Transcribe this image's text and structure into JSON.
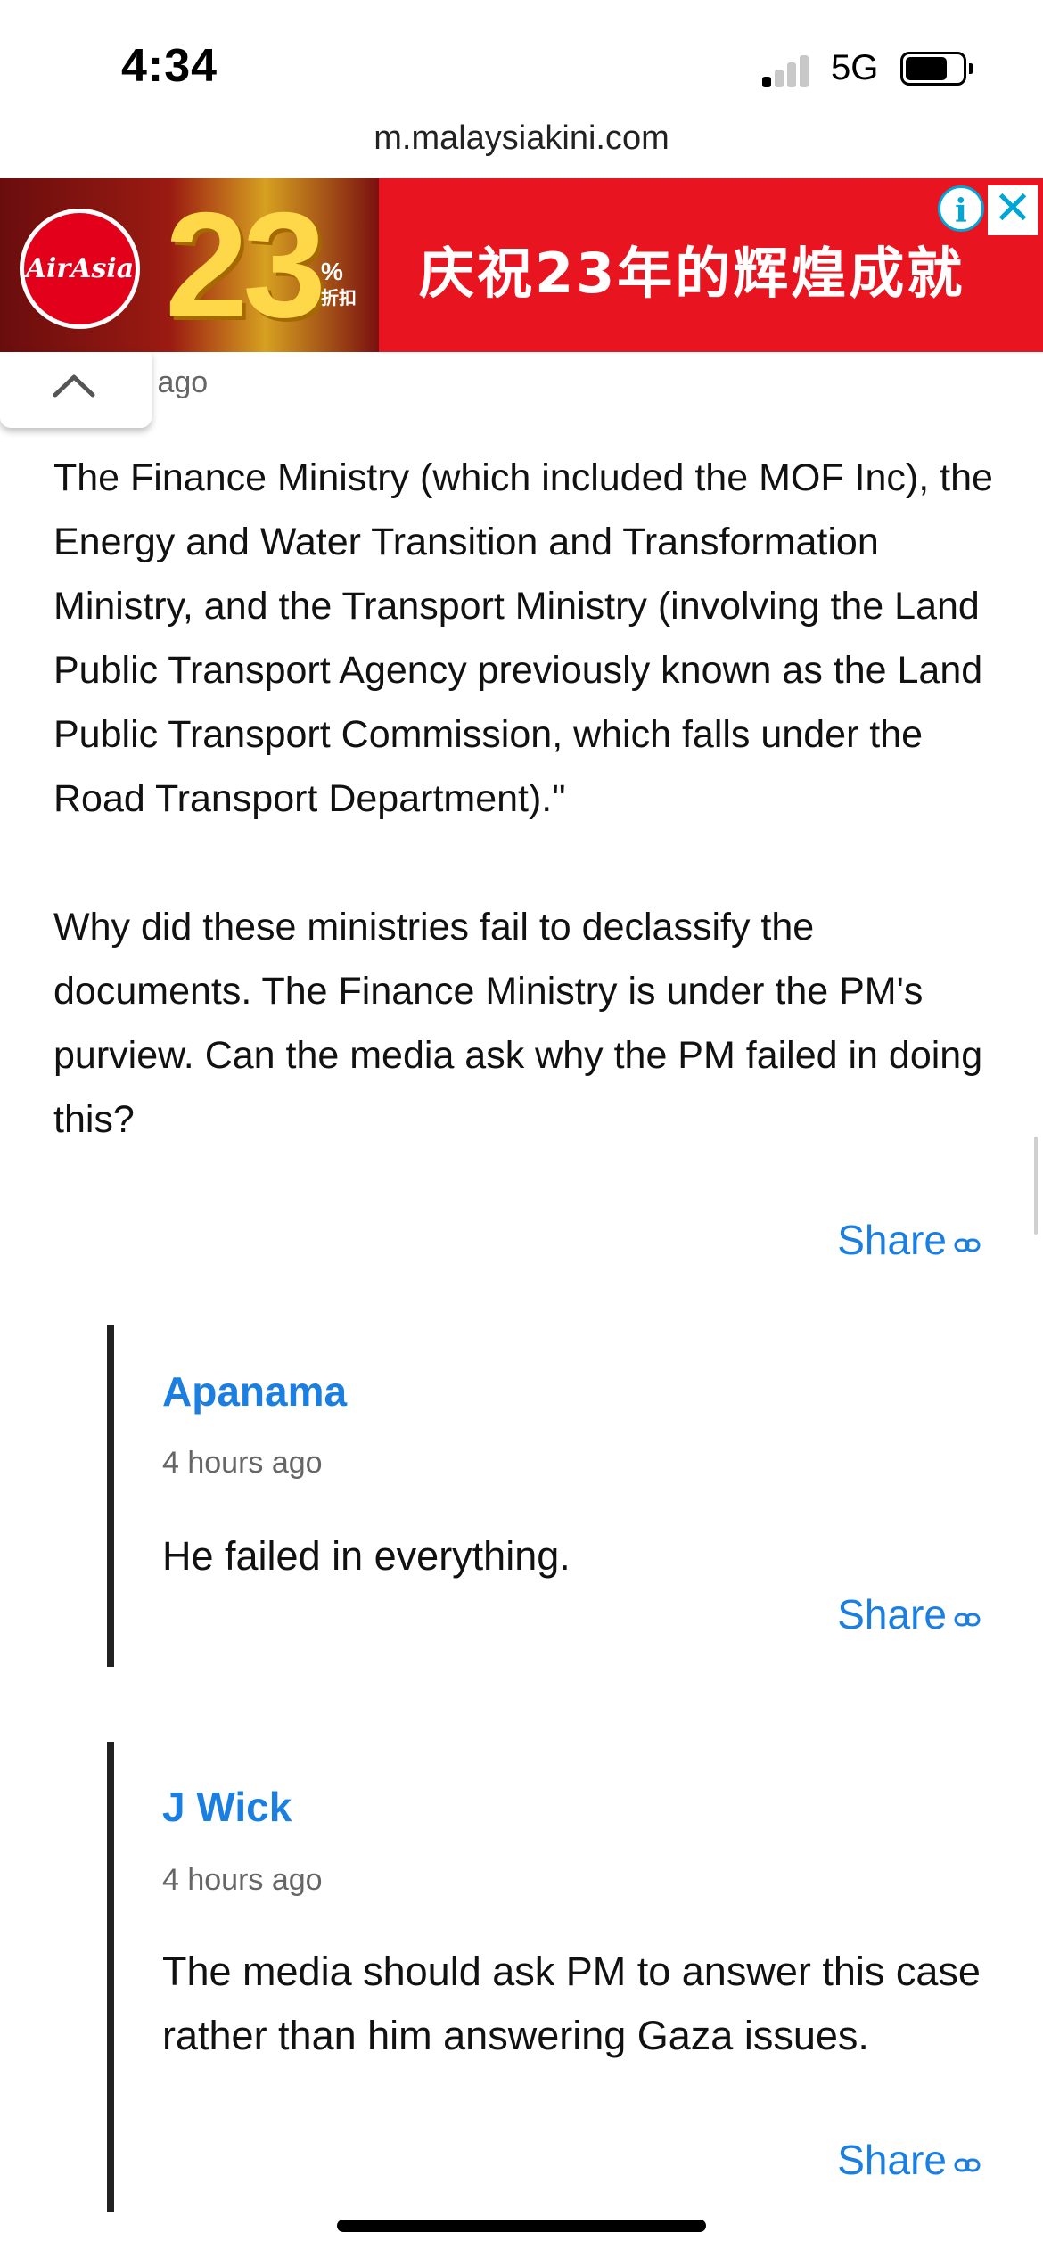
{
  "status_bar": {
    "time": "4:34",
    "network": "5G",
    "signal_bars_active": 1,
    "signal_bars_total": 4,
    "battery_level": 0.7
  },
  "browser": {
    "url": "m.malaysiakini.com"
  },
  "ad": {
    "brand": "AirAsia",
    "number": "23",
    "pct_label": "%",
    "pct_sub": "折扣",
    "tagline": "庆祝23年的辉煌成就",
    "info_icon": "info-icon",
    "close_icon": "close-icon"
  },
  "comment": {
    "time_partial": "s ago",
    "paragraphs": [
      "The Finance Ministry (which included the MOF Inc), the Energy and Water Transition and Transformation Ministry, and the Transport Ministry (involving the Land Public Transport Agency previously known as the Land Public Transport Commission, which falls under the Road Transport Department).\"",
      "Why did these ministries fail to declassify the documents. The Finance Ministry is under the PM's purview. Can the media ask why the PM failed in doing this?"
    ],
    "share_label": "Share"
  },
  "replies": [
    {
      "author": "Apanama",
      "time": "4 hours ago",
      "text": "He failed in everything.",
      "share_label": "Share"
    },
    {
      "author": "J Wick",
      "time": "4 hours ago",
      "text": "The media should ask PM to answer this case rather than him answering Gaza issues.",
      "share_label": "Share"
    }
  ],
  "colors": {
    "link": "#1a7fe0",
    "ad_red": "#e8141f",
    "meta_text": "#666666"
  }
}
